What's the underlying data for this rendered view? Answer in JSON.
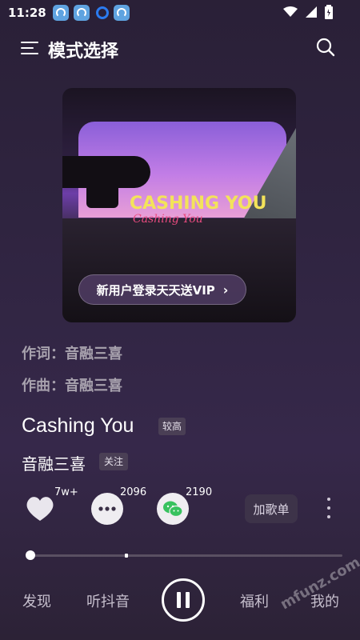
{
  "status_bar": {
    "time": "11:28"
  },
  "header": {
    "title": "模式选择"
  },
  "cover": {
    "art_title": "CASHING YOU",
    "art_subtitle": "Cashing You",
    "vip_banner": "新用户登录天天送VIP",
    "vip_chevron": "›"
  },
  "credits": {
    "lyricist": "作词：音融三喜",
    "composer": "作曲：音融三喜"
  },
  "song": {
    "title": "Cashing You",
    "quality": "较高",
    "artist": "音融三喜",
    "follow": "关注"
  },
  "actions": {
    "like_count": "7w+",
    "comment_count": "2096",
    "share_count": "2190",
    "add_playlist": "加歌单"
  },
  "progress": {
    "played_fraction": 0.01,
    "buffered_fraction": 0.31
  },
  "bottom_nav": {
    "discover": "发现",
    "douyin": "听抖音",
    "welfare": "福利",
    "mine": "我的"
  },
  "watermark": "mfunz.com 魔趣网",
  "colors": {
    "background": "#2f2440",
    "vip_gold": "#f3e35a",
    "wechat_green": "#38c25f"
  }
}
